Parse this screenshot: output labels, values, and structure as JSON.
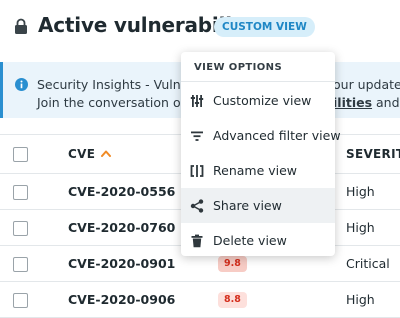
{
  "header": {
    "title": "Active vulnerabilites",
    "badge": "CUSTOM VIEW"
  },
  "banner": {
    "line1_left": "Security Insights - Vulnera",
    "line1_right": "our updated",
    "line2_left_prefix": "Join the conversation on ",
    "line2_left_link": "S",
    "line2_right_link": "ilities",
    "line2_right_suffix": " and g"
  },
  "table": {
    "columns": {
      "cve": "CVE",
      "severity": "SEVERITY"
    },
    "rows": [
      {
        "cve": "CVE-2020-0556",
        "score": "",
        "severity": "High"
      },
      {
        "cve": "CVE-2020-0760",
        "score": "",
        "severity": "High"
      },
      {
        "cve": "CVE-2020-0901",
        "score": "9.8",
        "severity": "Critical"
      },
      {
        "cve": "CVE-2020-0906",
        "score": "8.8",
        "severity": "High"
      }
    ]
  },
  "menu": {
    "heading": "VIEW OPTIONS",
    "items": [
      {
        "label": "Customize view",
        "icon": "tune-icon"
      },
      {
        "label": "Advanced filter view",
        "icon": "filter-icon"
      },
      {
        "label": "Rename view",
        "icon": "rename-icon"
      },
      {
        "label": "Share view",
        "icon": "share-icon"
      },
      {
        "label": "Delete view",
        "icon": "trash-icon"
      }
    ]
  },
  "colors": {
    "accent": "#1f87c5",
    "badge_bg": "#d6eefa",
    "sort_arrow": "#f08a24",
    "score_red": "#d42e1d"
  }
}
